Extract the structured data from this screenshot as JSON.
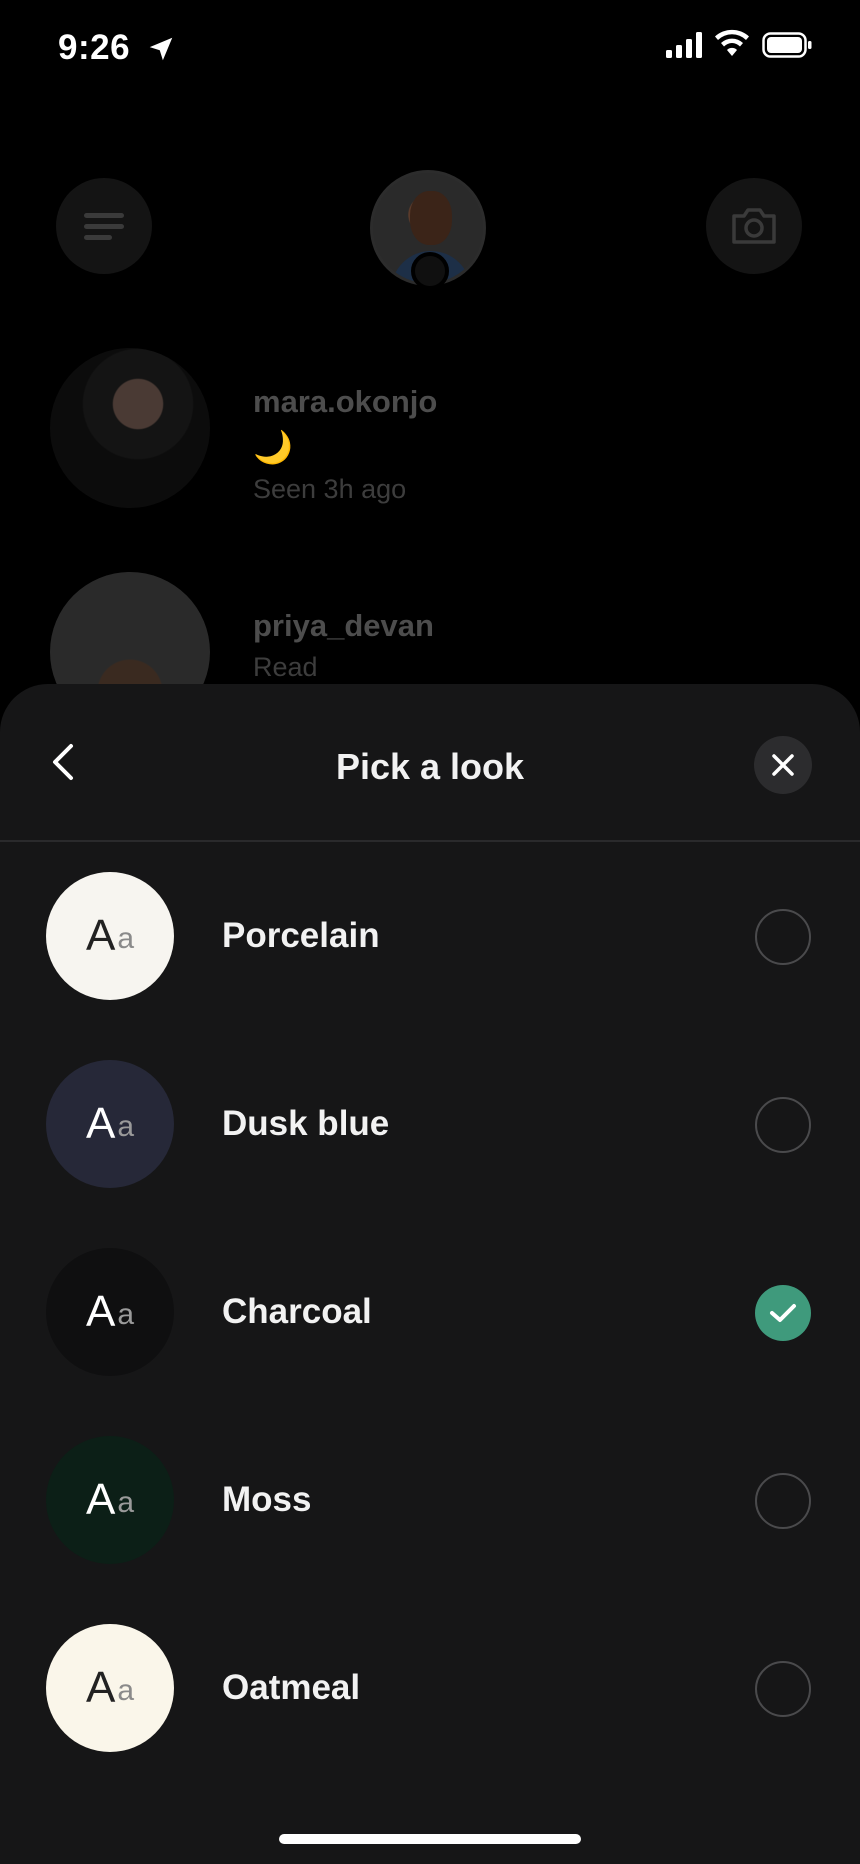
{
  "status_bar": {
    "time": "9:26"
  },
  "background_list": {
    "chats": [
      {
        "name": "mara.okonjo",
        "emoji": "🌙",
        "status": "Seen 3h ago"
      },
      {
        "name": "priya_devan",
        "status": "Read"
      }
    ]
  },
  "sheet": {
    "title": "Pick a look",
    "swatch_text_big": "A",
    "swatch_text_small": "a",
    "options": [
      {
        "label": "Porcelain",
        "swatch_color": "#f7f5f0",
        "text_color": "#222222",
        "selected": false
      },
      {
        "label": "Dusk blue",
        "swatch_color": "#262838",
        "text_color": "#ffffff",
        "selected": false
      },
      {
        "label": "Charcoal",
        "swatch_color": "#0f0f10",
        "text_color": "#ffffff",
        "selected": true
      },
      {
        "label": "Moss",
        "swatch_color": "#0c1f17",
        "text_color": "#ffffff",
        "selected": false
      },
      {
        "label": "Oatmeal",
        "swatch_color": "#faf6ea",
        "text_color": "#222222",
        "selected": false
      }
    ]
  },
  "colors": {
    "sheet_background": "#161617",
    "selected_accent": "#3f9a7c"
  }
}
